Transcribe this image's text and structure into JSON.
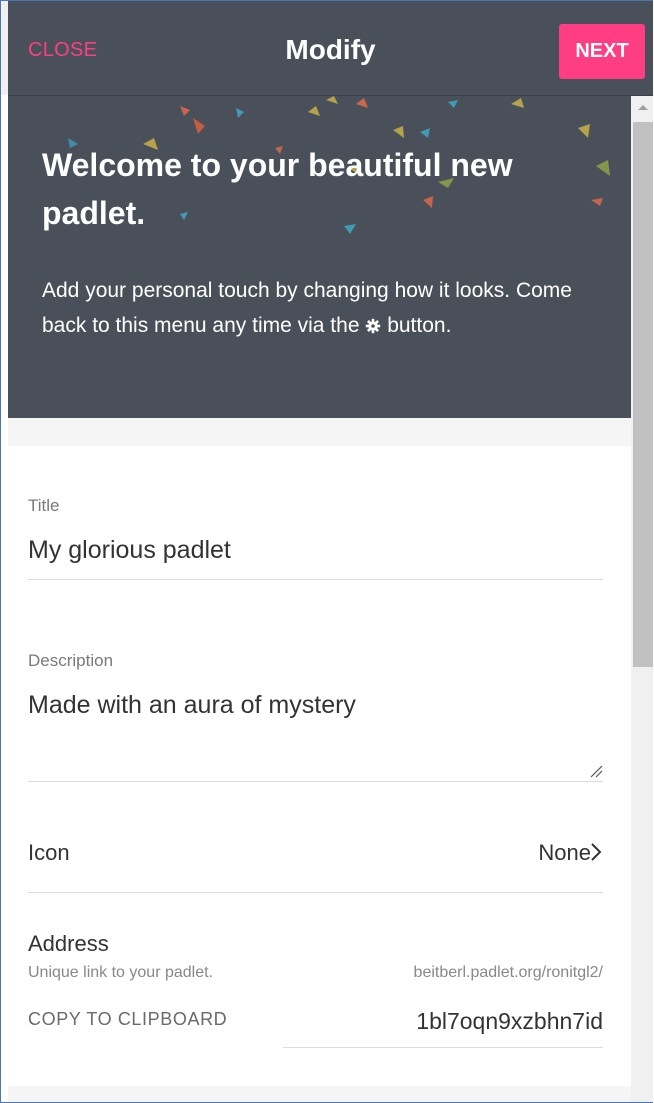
{
  "header": {
    "close_label": "CLOSE",
    "title": "Modify",
    "next_label": "NEXT"
  },
  "hero": {
    "title": "Welcome to your beautiful new padlet.",
    "body_before_icon": "Add your personal touch by changing how it looks. Come back to this menu any time via the",
    "body_after_icon": "button.",
    "icon": "gear-icon"
  },
  "form": {
    "title_label": "Title",
    "title_value": "My glorious padlet",
    "description_label": "Description",
    "description_value": "Made with an aura of mystery",
    "icon_label": "Icon",
    "icon_value": "None",
    "address_label": "Address",
    "address_hint": "Unique link to your padlet.",
    "address_prefix": "beitberl.padlet.org/ronitgl2/",
    "copy_label": "COPY TO CLIPBOARD",
    "address_slug": "1bl7oqn9xzbhn7id"
  },
  "colors": {
    "accent": "#ff3d83",
    "header_bg": "#4a5059",
    "text": "#333333"
  }
}
